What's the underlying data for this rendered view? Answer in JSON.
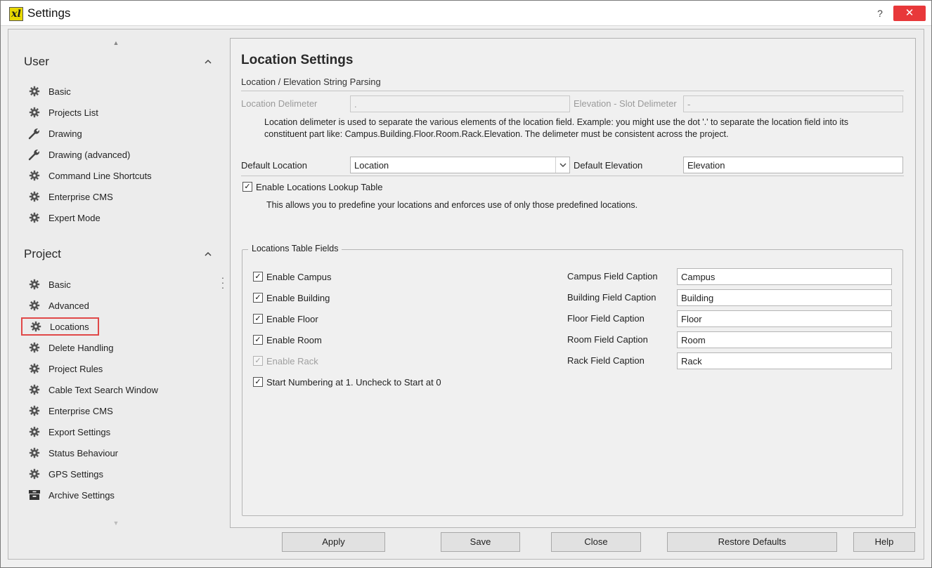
{
  "window": {
    "title": "Settings",
    "help_glyph": "?",
    "close_glyph": "✕",
    "app_icon_text": "xl"
  },
  "sidebar": {
    "user": {
      "title": "User",
      "items": [
        {
          "label": "Basic",
          "icon": "gear-icon"
        },
        {
          "label": "Projects List",
          "icon": "gear-icon"
        },
        {
          "label": "Drawing",
          "icon": "wrench-icon"
        },
        {
          "label": "Drawing (advanced)",
          "icon": "wrench-icon"
        },
        {
          "label": "Command Line Shortcuts",
          "icon": "gear-icon"
        },
        {
          "label": "Enterprise CMS",
          "icon": "gear-icon"
        },
        {
          "label": "Expert Mode",
          "icon": "gear-icon"
        }
      ]
    },
    "project": {
      "title": "Project",
      "items": [
        {
          "label": "Basic",
          "icon": "gear-icon"
        },
        {
          "label": "Advanced",
          "icon": "gear-icon"
        },
        {
          "label": "Locations",
          "icon": "gear-icon",
          "selected": true
        },
        {
          "label": "Delete Handling",
          "icon": "gear-icon"
        },
        {
          "label": "Project Rules",
          "icon": "gear-icon"
        },
        {
          "label": "Cable Text Search Window",
          "icon": "gear-icon"
        },
        {
          "label": "Enterprise CMS",
          "icon": "gear-icon"
        },
        {
          "label": "Export Settings",
          "icon": "gear-icon"
        },
        {
          "label": "Status Behaviour",
          "icon": "gear-icon"
        },
        {
          "label": "GPS Settings",
          "icon": "gear-icon"
        },
        {
          "label": "Archive Settings",
          "icon": "archive-icon"
        }
      ]
    }
  },
  "main": {
    "title": "Location Settings",
    "parsing_section": "Location / Elevation String Parsing",
    "location_delimeter_label": "Location Delimeter",
    "location_delimeter_value": ".",
    "elevation_delimeter_label": "Elevation - Slot Delimeter",
    "elevation_delimeter_value": "-",
    "delimeter_desc_line1": "Location delimeter is used to separate the various elements of the location field. Example: you might use the dot '.' to separate the location field into its",
    "delimeter_desc_line2": "constituent part like: Campus.Building.Floor.Room.Rack.Elevation. The delimeter must be consistent across the project.",
    "default_location_label": "Default Location",
    "default_location_value": "Location",
    "default_elevation_label": "Default Elevation",
    "default_elevation_value": "Elevation",
    "enable_lookup_label": "Enable Locations Lookup Table",
    "enable_lookup_checked": true,
    "lookup_desc": "This allows you to predefine your locations and enforces use of only those predefined locations.",
    "table_fields": {
      "title": "Locations Table Fields",
      "rows": [
        {
          "check_label": "Enable Campus",
          "checked": true,
          "disabled": false,
          "caption_label": "Campus Field Caption",
          "caption_value": "Campus"
        },
        {
          "check_label": "Enable Building",
          "checked": true,
          "disabled": false,
          "caption_label": "Building Field Caption",
          "caption_value": "Building"
        },
        {
          "check_label": "Enable Floor",
          "checked": true,
          "disabled": false,
          "caption_label": "Floor Field Caption",
          "caption_value": "Floor"
        },
        {
          "check_label": "Enable Room",
          "checked": true,
          "disabled": false,
          "caption_label": "Room Field Caption",
          "caption_value": "Room"
        },
        {
          "check_label": "Enable Rack",
          "checked": true,
          "disabled": true,
          "caption_label": "Rack Field Caption",
          "caption_value": "Rack"
        }
      ],
      "start_numbering_label": "Start Numbering at 1. Uncheck to Start at 0",
      "start_numbering_checked": true
    }
  },
  "buttons": {
    "apply": "Apply",
    "save": "Save",
    "close": "Close",
    "restore": "Restore Defaults",
    "help": "Help"
  },
  "check_glyph": "✓"
}
